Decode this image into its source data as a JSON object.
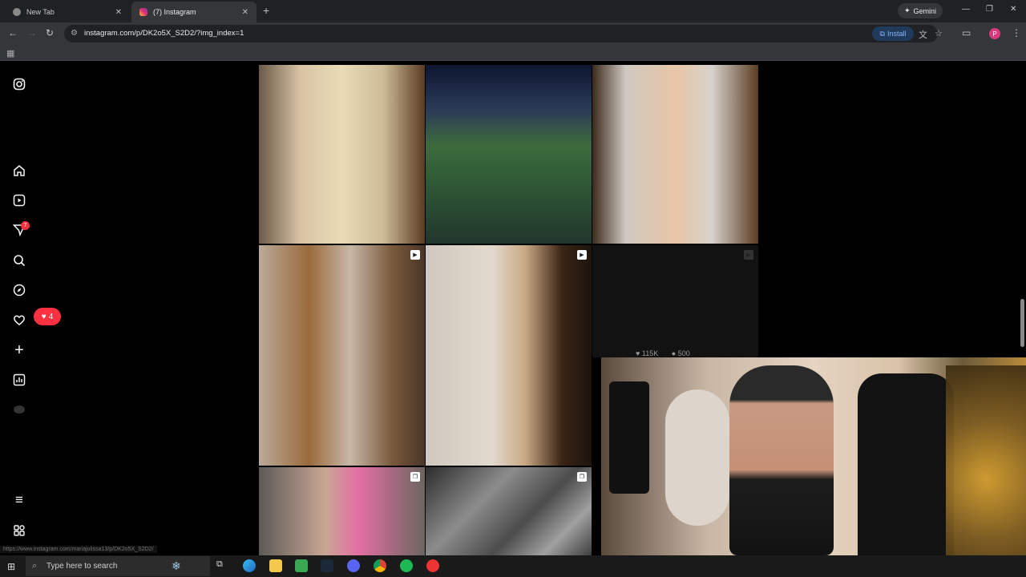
{
  "browser": {
    "tabs": [
      {
        "label": "New Tab",
        "close": "✕"
      },
      {
        "label": "(7) Instagram",
        "close": "✕"
      }
    ],
    "new_tab": "+",
    "gemini_label": "Gemini",
    "window_controls": [
      "—",
      "❐",
      "✕"
    ],
    "url": "instagram.com/p/DK2o5X_S2D2/?img_index=1",
    "install_label": "Install",
    "profile_initial": "P",
    "status_url": "https://www.instagram.com/mariajulissa13/p/DK2o5X_S2D2/"
  },
  "instagram": {
    "notifications_badge": "7",
    "likes_pill_count": "4",
    "tile_stats": {
      "likes": "115K",
      "comments": "500"
    }
  },
  "taskbar": {
    "search_placeholder": "Type here to search"
  },
  "colors": {
    "accent_red": "#ff3040",
    "chrome_dark": "#202124",
    "chrome_mid": "#35363a",
    "install_blue": "#8ab4f8"
  }
}
